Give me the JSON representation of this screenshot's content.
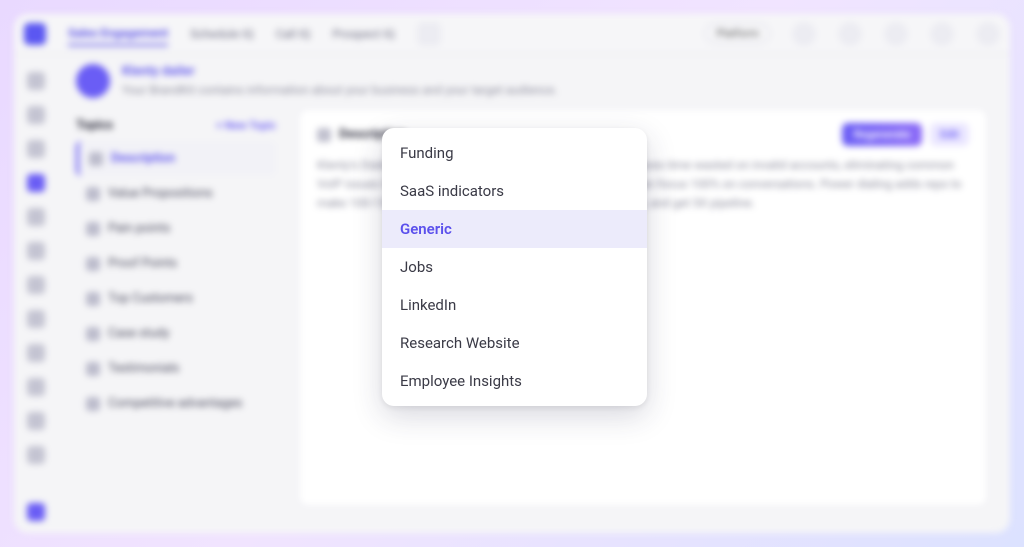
{
  "topnav": {
    "tabs": [
      "Sales Engagement",
      "Schedule IQ",
      "Call IQ",
      "Prospect IQ"
    ],
    "platform_label": "Platform"
  },
  "brand": {
    "title": "Klenty dailer",
    "subtitle": "Your BrandKit contains information about your business and your target audience."
  },
  "topics": {
    "heading": "Topics",
    "new_label": "+ New Topic",
    "items": [
      "Description",
      "Value Propositions",
      "Pain points",
      "Proof Points",
      "Top Customers",
      "Case study",
      "Testimonials",
      "Competitive advantages"
    ],
    "active_index": 0
  },
  "main": {
    "title": "Description",
    "regenerate_label": "Regenerate",
    "edit_label": "Edit",
    "body": "Klenty's Dialer automatically dials numbers from your CRM, saves time wasted on invalid accounts, eliminating common VoIP issues like jitters, latency, and call drops—so your reps can focus 100% on conversations. Power dialing adds reps to make 100-150 calls per hour, achieve up to 40% connect rates, and get 5X pipeline."
  },
  "dropdown": {
    "options": [
      "Funding",
      "SaaS indicators",
      "Generic",
      "Jobs",
      "LinkedIn",
      "Research Website",
      "Employee Insights"
    ],
    "selected_index": 2
  }
}
